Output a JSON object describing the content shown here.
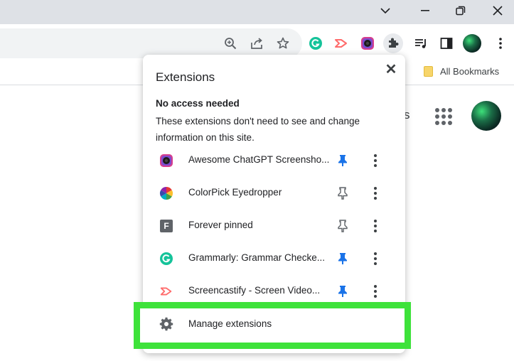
{
  "window": {
    "minimize_icon": "chevron-down-icon",
    "controls": [
      "minimize",
      "restore",
      "close"
    ]
  },
  "toolbar": {
    "icons": [
      "zoom-icon",
      "share-icon",
      "bookmark-star-icon",
      "grammarly-icon",
      "screencastify-icon",
      "awesome-screenshot-icon",
      "extensions-puzzle-icon",
      "reading-list-icon",
      "side-panel-icon",
      "profile-avatar"
    ]
  },
  "bookmarks_bar": {
    "all_bookmarks": "All Bookmarks"
  },
  "page": {
    "fragment_text": "s"
  },
  "extensions_popup": {
    "title": "Extensions",
    "close_glyph": "✕",
    "section_heading": "No access needed",
    "section_description": "These extensions don't need to see and change information on this site.",
    "items": [
      {
        "name": "Awesome ChatGPT Screensho...",
        "icon": "awesome-screenshot-icon",
        "pinned": true
      },
      {
        "name": "ColorPick Eyedropper",
        "icon": "colorpick-icon",
        "pinned": false
      },
      {
        "name": "Forever pinned",
        "icon": "forever-pinned-icon",
        "icon_letter": "F",
        "pinned": false
      },
      {
        "name": "Grammarly: Grammar Checke...",
        "icon": "grammarly-icon",
        "pinned": true
      },
      {
        "name": "Screencastify - Screen Video...",
        "icon": "screencastify-icon",
        "pinned": true
      }
    ],
    "manage_label": "Manage extensions"
  },
  "colors": {
    "highlight": "#3ee23a",
    "pinned": "#1a73e8",
    "unpinned": "#5f6368",
    "grammarly": "#15c39a",
    "screencastify": "#ff6b6b"
  }
}
